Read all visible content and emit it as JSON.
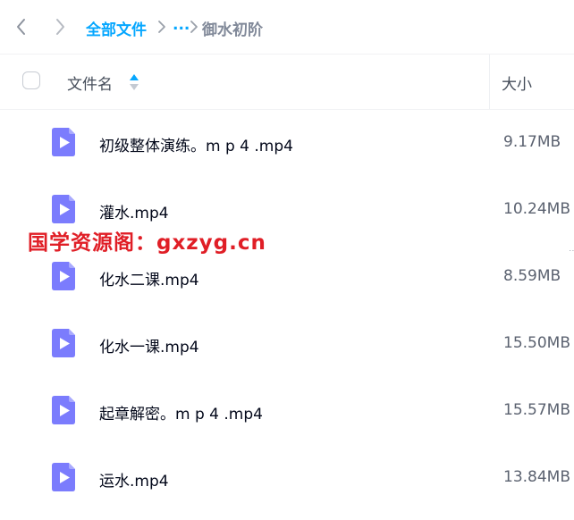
{
  "breadcrumb": {
    "back_icon": "chevron-left-icon",
    "forward_icon": "chevron-right-icon",
    "root": "全部文件",
    "ellipsis": "...",
    "current": "御水初阶"
  },
  "table": {
    "columns": {
      "name": "文件名",
      "size": "大小"
    },
    "rows": [
      {
        "name": "初级整体演练。m p 4 .mp4",
        "size": "9.17MB",
        "icon": "video-file-icon"
      },
      {
        "name": "灌水.mp4",
        "size": "10.24MB",
        "icon": "video-file-icon"
      },
      {
        "name": "化水二课.mp4",
        "size": "8.59MB",
        "icon": "video-file-icon"
      },
      {
        "name": "化水一课.mp4",
        "size": "15.50MB",
        "icon": "video-file-icon"
      },
      {
        "name": "起章解密。m p 4 .mp4",
        "size": "15.57MB",
        "icon": "video-file-icon"
      },
      {
        "name": "运水.mp4",
        "size": "13.84MB",
        "icon": "video-file-icon"
      }
    ]
  },
  "watermark": {
    "prefix": "国学资源阁：",
    "url": "gxzyg.cn"
  },
  "colors": {
    "accent": "#06a7ff",
    "icon": "#7b7cfd",
    "watermark": "#e01e26"
  }
}
